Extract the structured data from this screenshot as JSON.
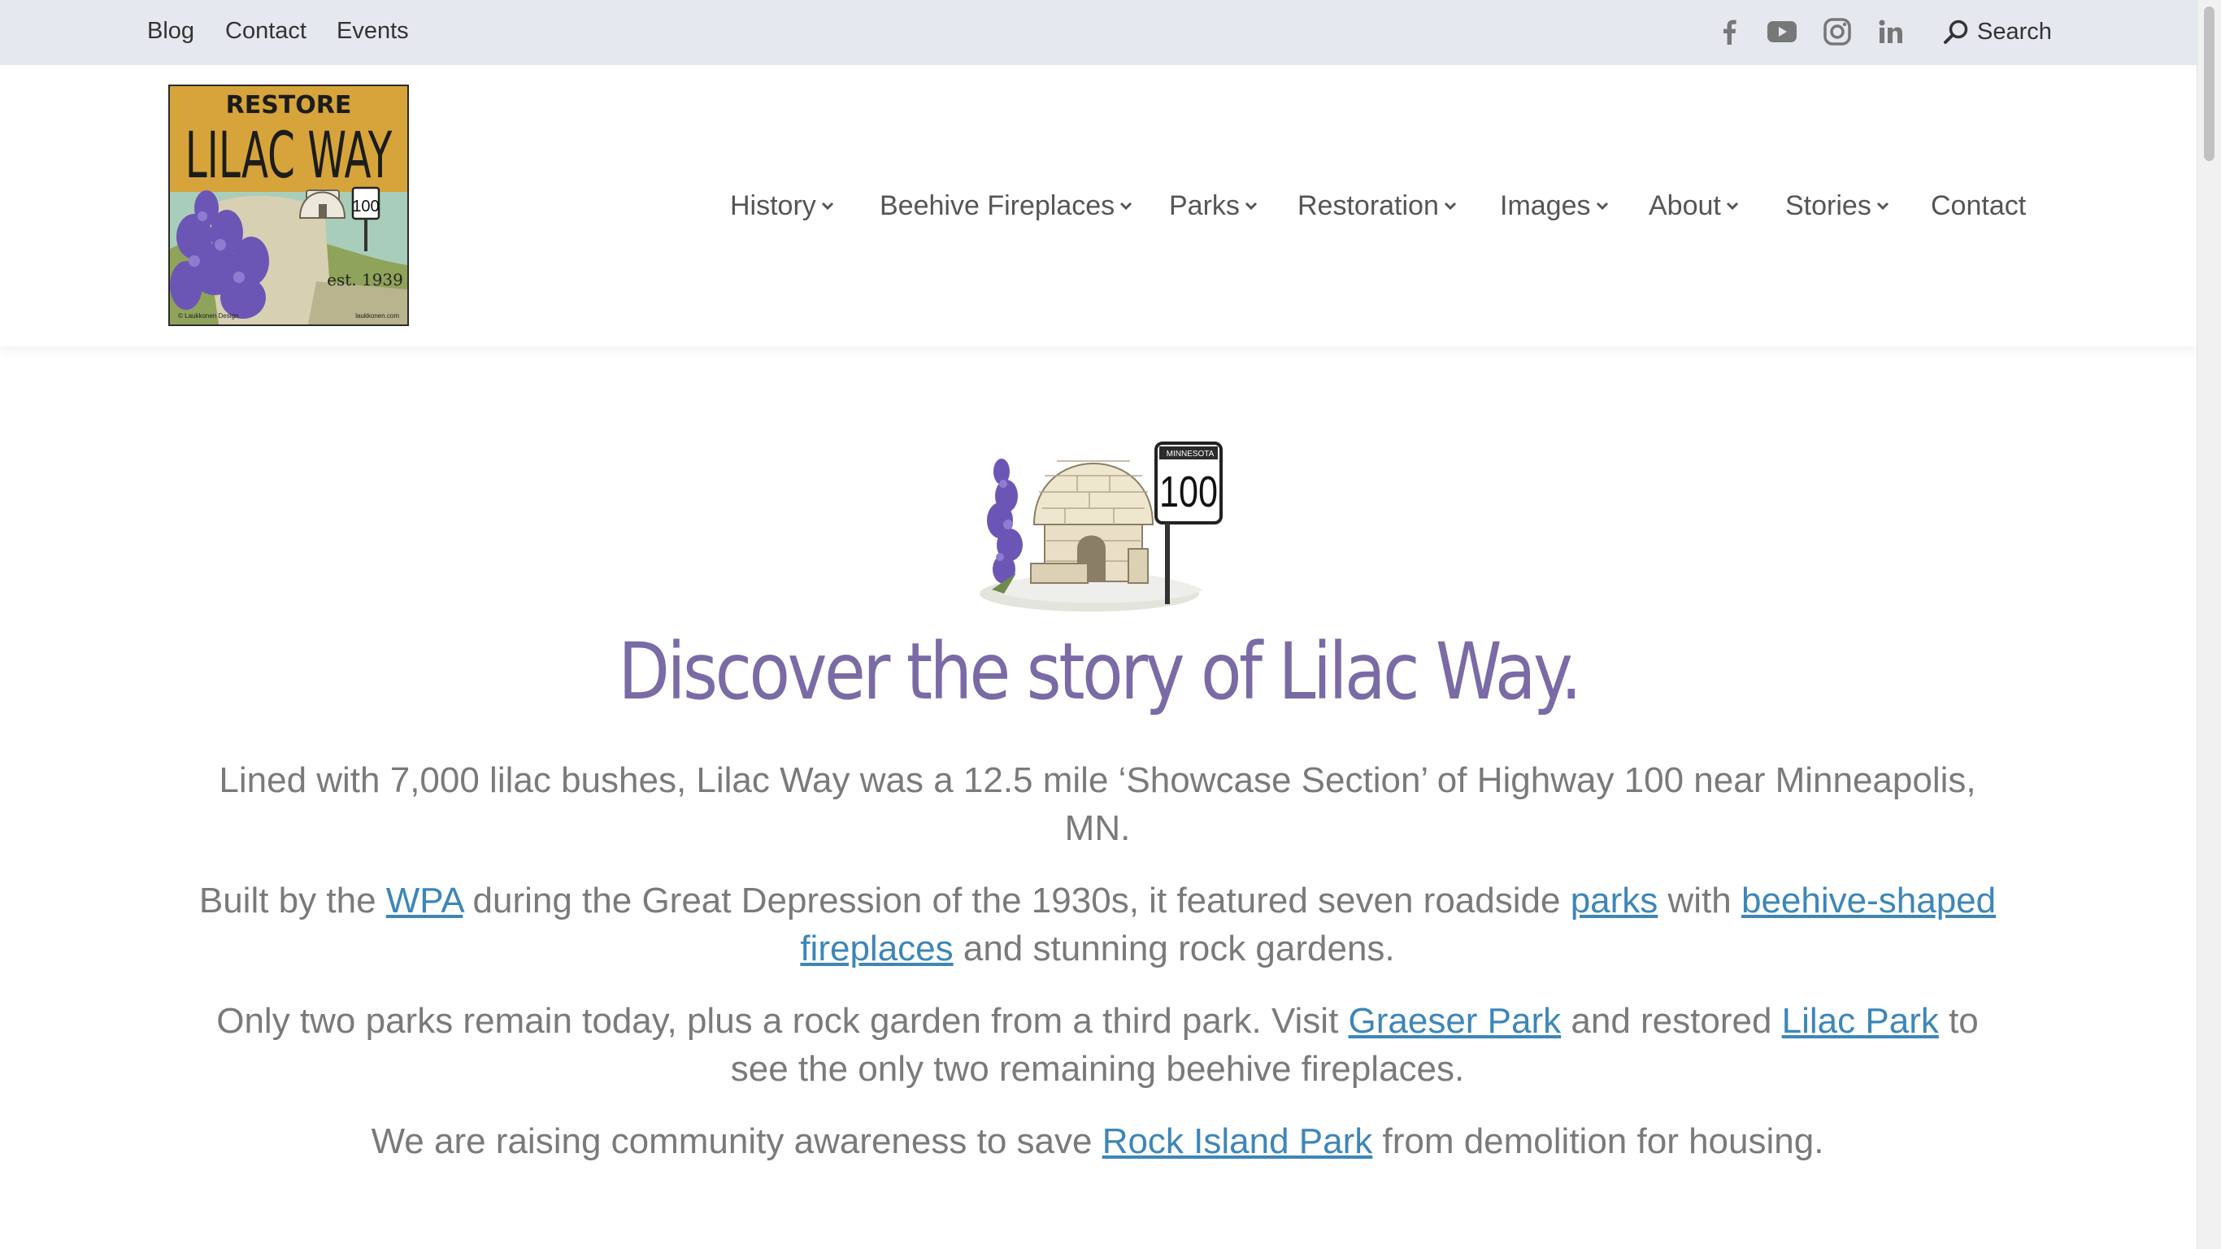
{
  "topbar": {
    "links": [
      "Blog",
      "Contact",
      "Events"
    ],
    "social": [
      "facebook-icon",
      "youtube-icon",
      "instagram-icon",
      "linkedin-icon"
    ],
    "search_label": "Search"
  },
  "logo": {
    "line1": "RESTORE",
    "line2": "LILAC WAY",
    "sign": "100",
    "est": "est. 1939",
    "credit_left": "© Laukkonen Design",
    "credit_right": "laukkonen.com"
  },
  "nav": {
    "items": [
      {
        "label": "History",
        "dropdown": true
      },
      {
        "label": "Beehive Fireplaces",
        "dropdown": true
      },
      {
        "label": "Parks",
        "dropdown": true
      },
      {
        "label": "Restoration",
        "dropdown": true
      },
      {
        "label": "Images",
        "dropdown": true
      },
      {
        "label": "About",
        "dropdown": true
      },
      {
        "label": "Stories",
        "dropdown": true
      },
      {
        "label": "Contact",
        "dropdown": false
      }
    ]
  },
  "hero": {
    "sign_state": "MINNESOTA",
    "sign_number": "100",
    "headline": "Discover the story of Lilac Way."
  },
  "content": {
    "p1": "Lined with 7,000 lilac bushes, Lilac Way was a 12.5 mile ‘Showcase Section’ of Highway 100 near Minneapolis, MN.",
    "p2": {
      "t1": "Built by the ",
      "link1": "WPA",
      "t2": " during the Great Depression of the 1930s, it featured seven roadside ",
      "link2": "parks",
      "t3": " with ",
      "link3": "beehive-shaped fireplaces",
      "t4": " and stunning rock gardens."
    },
    "p3": {
      "t1": "Only two parks remain today, plus a rock garden from a third park. Visit ",
      "link1": "Graeser Park",
      "t2": " and restored ",
      "link2": "Lilac Park",
      "t3": " to see the only two remaining beehive fireplaces."
    },
    "p4": {
      "t1": "We are raising community awareness to save ",
      "link1": "Rock Island Park",
      "t2": " from demolition for housing."
    }
  },
  "colors": {
    "topbar_bg": "#e6e8ef",
    "headline": "#7a6aa6",
    "link": "#3d86b8",
    "body_text": "#7a7a7a"
  }
}
